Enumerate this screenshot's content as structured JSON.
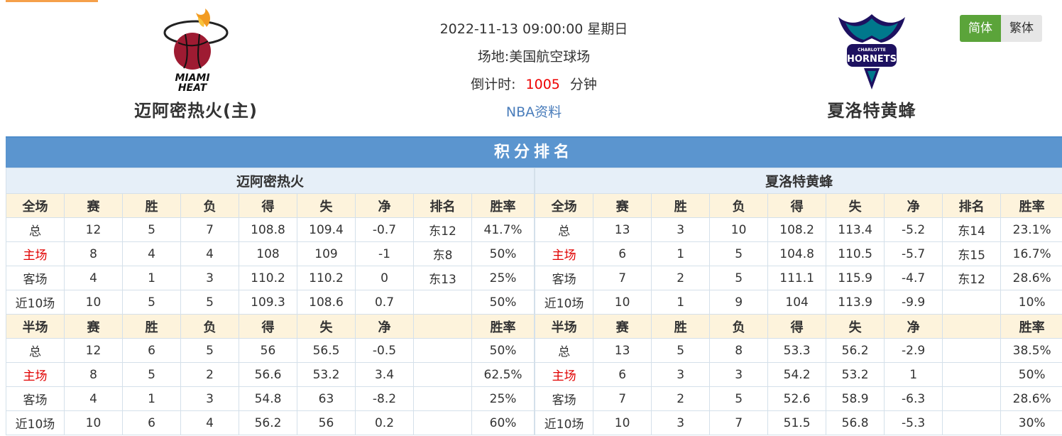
{
  "match": {
    "datetime": "2022-11-13 09:00:00 星期日",
    "venue_label": "场地:",
    "venue": "美国航空球场",
    "countdown_label": "倒计时:",
    "countdown_value": "1005",
    "countdown_unit": "分钟",
    "data_link": "NBA资料"
  },
  "home": {
    "name": "迈阿密热火(主)",
    "logo_text_1": "MIAMI",
    "logo_text_2": "HEAT"
  },
  "away": {
    "name": "夏洛特黄蜂",
    "logo_text_1": "CHARLOTTE",
    "logo_text_2": "HORNETS"
  },
  "language": {
    "simplified": "简体",
    "traditional": "繁体"
  },
  "standings": {
    "title": "积分排名",
    "headers_full": [
      "全场",
      "赛",
      "胜",
      "负",
      "得",
      "失",
      "净",
      "排名",
      "胜率"
    ],
    "headers_half": [
      "半场",
      "赛",
      "胜",
      "负",
      "得",
      "失",
      "净",
      "",
      "胜率"
    ],
    "teams": [
      {
        "name": "迈阿密热火",
        "full": [
          [
            "总",
            "12",
            "5",
            "7",
            "108.8",
            "109.4",
            "-0.7",
            "东12",
            "41.7%"
          ],
          [
            "主场",
            "8",
            "4",
            "4",
            "108",
            "109",
            "-1",
            "东8",
            "50%"
          ],
          [
            "客场",
            "4",
            "1",
            "3",
            "110.2",
            "110.2",
            "0",
            "东13",
            "25%"
          ],
          [
            "近10场",
            "10",
            "5",
            "5",
            "109.3",
            "108.6",
            "0.7",
            "",
            "50%"
          ]
        ],
        "half": [
          [
            "总",
            "12",
            "6",
            "5",
            "56",
            "56.5",
            "-0.5",
            "",
            "50%"
          ],
          [
            "主场",
            "8",
            "5",
            "2",
            "56.6",
            "53.2",
            "3.4",
            "",
            "62.5%"
          ],
          [
            "客场",
            "4",
            "1",
            "3",
            "54.8",
            "63",
            "-8.2",
            "",
            "25%"
          ],
          [
            "近10场",
            "10",
            "6",
            "4",
            "56.2",
            "56",
            "0.2",
            "",
            "60%"
          ]
        ]
      },
      {
        "name": "夏洛特黄蜂",
        "full": [
          [
            "总",
            "13",
            "3",
            "10",
            "108.2",
            "113.4",
            "-5.2",
            "东14",
            "23.1%"
          ],
          [
            "主场",
            "6",
            "1",
            "5",
            "104.8",
            "110.5",
            "-5.7",
            "东15",
            "16.7%"
          ],
          [
            "客场",
            "7",
            "2",
            "5",
            "111.1",
            "115.9",
            "-4.7",
            "东12",
            "28.6%"
          ],
          [
            "近10场",
            "10",
            "1",
            "9",
            "104",
            "113.9",
            "-9.9",
            "",
            "10%"
          ]
        ],
        "half": [
          [
            "总",
            "13",
            "5",
            "8",
            "53.3",
            "56.2",
            "-2.9",
            "",
            "38.5%"
          ],
          [
            "主场",
            "6",
            "3",
            "3",
            "54.2",
            "53.2",
            "1",
            "",
            "50%"
          ],
          [
            "客场",
            "7",
            "2",
            "5",
            "52.6",
            "58.9",
            "-6.3",
            "",
            "28.6%"
          ],
          [
            "近10场",
            "10",
            "3",
            "7",
            "51.5",
            "56.8",
            "-5.3",
            "",
            "30%"
          ]
        ]
      }
    ]
  },
  "colors": {
    "accent_blue": "#5b95cf",
    "header_yellow": "#fdf3dc",
    "active_green": "#5ba43a",
    "countdown_red": "#e00000"
  }
}
